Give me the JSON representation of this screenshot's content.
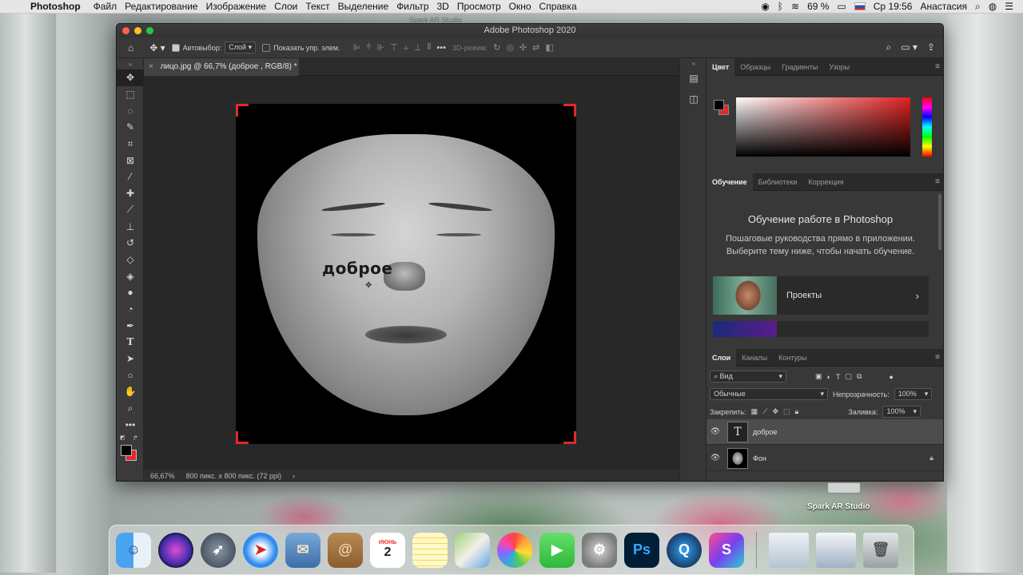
{
  "menubar": {
    "app_name": "Photoshop",
    "items": [
      "Файл",
      "Редактирование",
      "Изображение",
      "Слои",
      "Текст",
      "Выделение",
      "Фильтр",
      "3D",
      "Просмотр",
      "Окно",
      "Справка"
    ],
    "battery": "69 %",
    "clock": "Ср 19:56",
    "user": "Анастасия"
  },
  "background_window_title": "Spark AR Studio",
  "window": {
    "title": "Adobe Photoshop 2020"
  },
  "options_bar": {
    "autoselect_label": "Автовыбор:",
    "autoselect_value": "Слой",
    "show_transform_label": "Показать упр. элем.",
    "mode_3d_label": "3D-режим:"
  },
  "document": {
    "tab_title": "лицо.jpg @ 66,7% (доброе , RGB/8) *",
    "canvas_text": "доброе",
    "zoom": "66,67%",
    "doc_info": "800 пикс. x 800 пикс. (72 ppi)"
  },
  "color_panel": {
    "tabs": [
      "Цвет",
      "Образцы",
      "Градиенты",
      "Узоры"
    ],
    "foreground": "#000000",
    "background": "#e02a2a"
  },
  "learn_panel": {
    "tabs": [
      "Обучение",
      "Библиотеки",
      "Коррекция"
    ],
    "title": "Обучение работе в Photoshop",
    "description": "Пошаговые руководства прямо в приложении. Выберите тему ниже, чтобы начать обучение.",
    "card_label": "Проекты"
  },
  "layers_panel": {
    "tabs": [
      "Слои",
      "Каналы",
      "Контуры"
    ],
    "filter_label": "Вид",
    "blend_mode": "Обычные",
    "opacity_label": "Непрозрачность:",
    "opacity_value": "100%",
    "lock_label": "Закрепить:",
    "fill_label": "Заливка:",
    "fill_value": "100%",
    "layers": [
      {
        "name": "доброе",
        "type": "text",
        "selected": true
      },
      {
        "name": "Фон",
        "type": "image",
        "locked": true
      }
    ]
  },
  "dock": {
    "spark_label": "Spark AR Studio",
    "calendar_month": "ИЮНЬ",
    "calendar_day": "2",
    "ps_label": "Ps"
  },
  "colors": {
    "accent_red": "#e02a2a",
    "ps_blue": "#31a8ff"
  }
}
